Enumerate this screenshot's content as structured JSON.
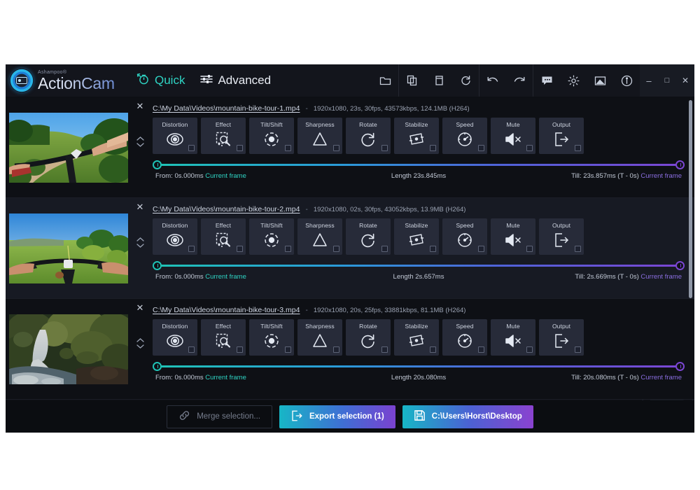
{
  "app": {
    "brand": "Ashampoo®",
    "name": "ActionCam"
  },
  "colors": {
    "accent_teal": "#2fd4c4",
    "accent_purple": "#7b46d4",
    "window_bg": "#14161d",
    "row_bg": "#171a23"
  },
  "titlebar": {
    "tabs": [
      {
        "label": "Quick",
        "icon": "stopwatch-icon",
        "active": true
      },
      {
        "label": "Advanced",
        "icon": "sliders-icon",
        "active": false
      }
    ],
    "tools": [
      {
        "name": "open-folder-icon"
      },
      {
        "name": "copy-icon"
      },
      {
        "name": "delete-icon"
      },
      {
        "name": "refresh-icon"
      },
      {
        "name": "undo-icon"
      },
      {
        "name": "redo-icon"
      },
      {
        "name": "feedback-icon"
      },
      {
        "name": "settings-gear-icon"
      },
      {
        "name": "image-icon"
      },
      {
        "name": "info-icon"
      }
    ],
    "window_controls": [
      {
        "name": "minimize-button",
        "glyph": "–"
      },
      {
        "name": "maximize-button",
        "glyph": "□"
      },
      {
        "name": "close-button",
        "glyph": "✕"
      }
    ]
  },
  "tool_labels": {
    "distortion": "Distortion",
    "effect": "Effect",
    "tiltshift": "Tilt/Shift",
    "sharpness": "Sharpness",
    "rotate": "Rotate",
    "stabilize": "Stabilize",
    "speed": "Speed",
    "mute": "Mute",
    "output": "Output"
  },
  "clips": [
    {
      "path": "C:\\My Data\\Videos\\mountain-bike-tour-1.mp4",
      "dash": "-",
      "meta": "1920x1080, 23s, 30fps, 43573kbps, 124.1MB (H264)",
      "from_label": "From: 0s.000ms",
      "from_link": "Current frame",
      "length_label": "Length  23s.845ms",
      "till_label": "Till: 23s.857ms (T - 0s)",
      "till_link": "Current frame",
      "thumbnail": "mountain-bike-trail-thumbnail"
    },
    {
      "path": "C:\\My Data\\Videos\\mountain-bike-tour-2.mp4",
      "dash": "-",
      "meta": "1920x1080, 02s, 30fps, 43052kbps, 13.9MB (H264)",
      "from_label": "From: 0s.000ms",
      "from_link": "Current frame",
      "length_label": "Length  2s.657ms",
      "till_label": "Till: 2s.669ms (T - 0s)",
      "till_link": "Current frame",
      "thumbnail": "meadow-handlebars-thumbnail"
    },
    {
      "path": "C:\\My Data\\Videos\\mountain-bike-tour-3.mp4",
      "dash": "-",
      "meta": "1920x1080, 20s, 25fps, 33881kbps, 81.1MB (H264)",
      "from_label": "From: 0s.000ms",
      "from_link": "Current frame",
      "length_label": "Length  20s.080ms",
      "till_label": "Till: 20s.080ms (T - 0s)",
      "till_link": "Current frame",
      "thumbnail": "waterfall-forest-thumbnail"
    }
  ],
  "bottom": {
    "merge_label": "Merge selection...",
    "export_label": "Export selection (1)",
    "destination_label": "C:\\Users\\Horst\\Desktop"
  }
}
